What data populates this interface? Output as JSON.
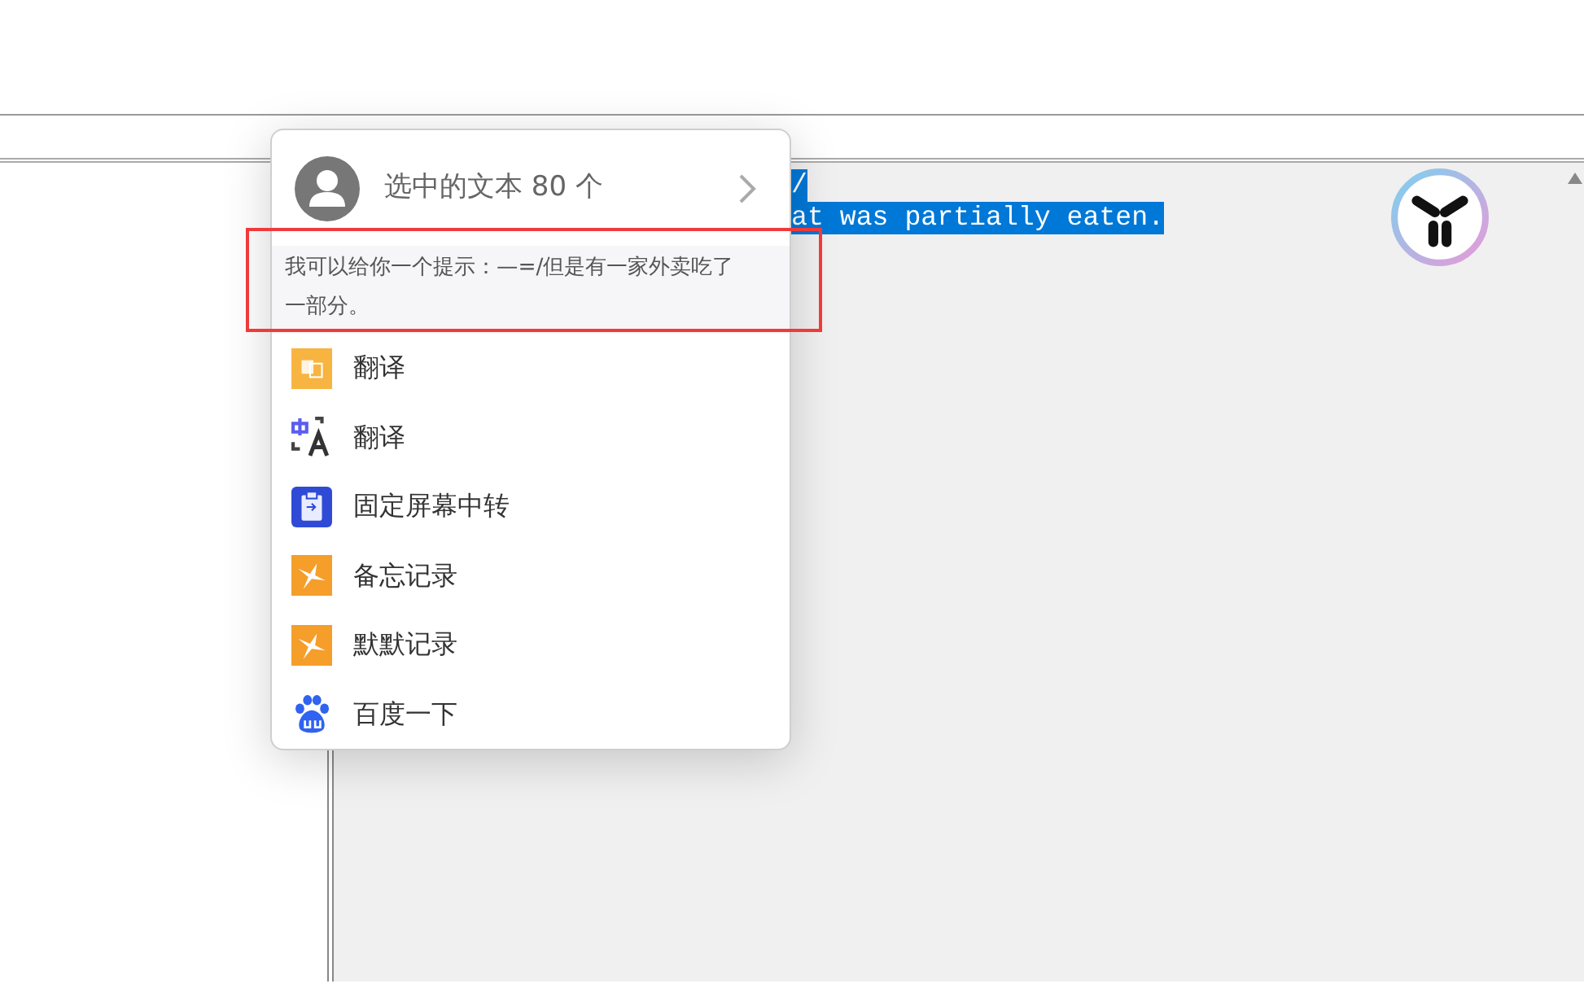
{
  "editor": {
    "lines": [
      {
        "text": "/",
        "selected": true
      },
      {
        "text": "at was partially eaten.",
        "selected": true
      }
    ]
  },
  "popup": {
    "header": {
      "label": "选中的文本 80 个"
    },
    "hint": "我可以给你一个提示：—=/但是有一家外卖吃了一部分。",
    "items": [
      {
        "label": "翻译",
        "kind": "doc-translate"
      },
      {
        "label": "翻译",
        "kind": "zh-translate"
      },
      {
        "label": "固定屏幕中转",
        "kind": "clipboard"
      },
      {
        "label": "备忘记录",
        "kind": "star"
      },
      {
        "label": "默默记录",
        "kind": "star"
      },
      {
        "label": "百度一下",
        "kind": "paw"
      }
    ]
  }
}
